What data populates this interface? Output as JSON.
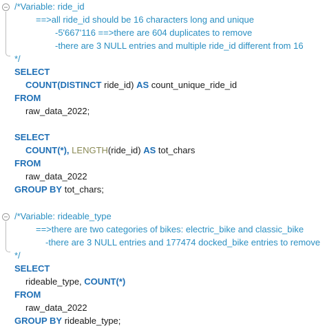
{
  "code": {
    "comment1": {
      "open": "/*Variable: ride_id",
      "l1": "==>all ride_id should be 16 characters long and unique",
      "l2": "-5'667'116 ==>there are 604 duplicates to remove",
      "l3": "-there are 3 NULL entries and multiple ride_id different from 16",
      "close": "*/"
    },
    "query1": {
      "select": "SELECT",
      "count_distinct": "COUNT(DISTINCT",
      "arg": " ride_id) ",
      "as": "AS",
      "alias": " count_unique_ride_id",
      "from": "FROM",
      "table": "raw_data_2022;"
    },
    "query2": {
      "select": "SELECT",
      "count": "COUNT",
      "count_arg": "(*), ",
      "length": "LENGTH",
      "length_arg": "(ride_id) ",
      "as": "AS",
      "alias": " tot_chars",
      "from": "FROM",
      "table": "raw_data_2022",
      "group_by": "GROUP BY",
      "group_col": " tot_chars;"
    },
    "comment2": {
      "open": "/*Variable: rideable_type",
      "l1": "==>there are two categories of bikes: electric_bike and classic_bike",
      "l2": "-there are 3 NULL entries and 177474 docked_bike entries to remove",
      "close": "*/"
    },
    "query3": {
      "select": "SELECT",
      "col": "rideable_type, ",
      "count": "COUNT",
      "count_arg": "(*)",
      "from": "FROM",
      "table": "raw_data_2022",
      "group_by": "GROUP BY",
      "group_col": " rideable_type;"
    }
  },
  "colors": {
    "comment": "#2a8fc2",
    "keyword": "#1f6fb5",
    "function_alt": "#8a8a55",
    "text": "#1a1a1a"
  }
}
